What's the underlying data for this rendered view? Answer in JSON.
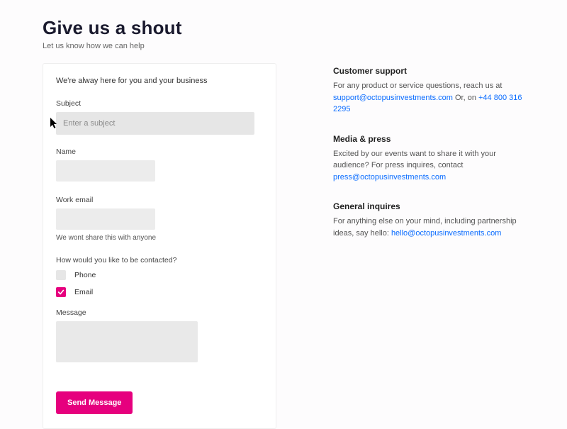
{
  "header": {
    "title": "Give us a shout",
    "subtitle": "Let us know how we can help"
  },
  "form": {
    "intro": "We're alway here for you and your business",
    "subject": {
      "label": "Subject",
      "placeholder": "Enter a subject"
    },
    "name": {
      "label": "Name"
    },
    "email": {
      "label": "Work email",
      "helper": "We wont share this with anyone"
    },
    "contactMethod": {
      "label": "How would you like to be contacted?",
      "phone": "Phone",
      "email": "Email"
    },
    "message": {
      "label": "Message"
    },
    "submit": "Send Message"
  },
  "info": {
    "support": {
      "heading": "Customer support",
      "text1": "For any product or service questions, reach us at ",
      "email": "support@octopusinvestments.com",
      "text2": " Or, on ",
      "phone": "+44 800 316 2295"
    },
    "press": {
      "heading": "Media & press",
      "text": "Excited by our events want to share it with your audience? For press inquires, contact ",
      "email": "press@octopusinvestments.com"
    },
    "general": {
      "heading": "General inquires",
      "text": "For anything else on your mind, including partnership ideas, say hello: ",
      "email": "hello@octopusinvestments.com"
    }
  },
  "colors": {
    "accent": "#e6007e",
    "link": "#0a6cff"
  }
}
